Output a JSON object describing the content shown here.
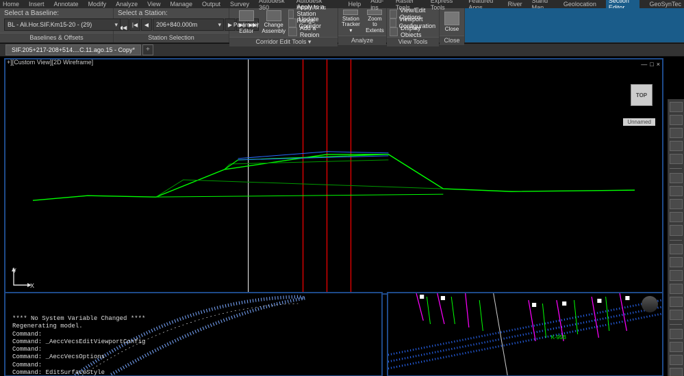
{
  "menu": {
    "items": [
      "Home",
      "Insert",
      "Annotate",
      "Modify",
      "Analyze",
      "View",
      "Manage",
      "Output",
      "Survey",
      "Autodesk 360",
      "Autodesk InfraWorks",
      "Help",
      "Add-ins",
      "Raster Tools",
      "Express Tools",
      "Featured Apps",
      "River",
      "Stand Man",
      "Geolocation",
      "Section Editor",
      "GeoSynTec"
    ],
    "active": "Section Editor"
  },
  "ribbon": {
    "baselines": {
      "label": "Select a Baseline:",
      "value": "BL - Ali.Hor.SIF.Km15-20 - (29)",
      "title": "Baselines & Offsets"
    },
    "station": {
      "label": "Select a Station:",
      "value": "206+840.000m",
      "title": "Station Selection",
      "nav": [
        "|◀◀",
        "|◀",
        "◀",
        "▶",
        "▶|",
        "▶▶|"
      ]
    },
    "tools": {
      "param": "Parameter Editor",
      "assem": "Change Assembly",
      "range": "Apply to a Station Range",
      "update": "Update Corridor",
      "region": "Add a Region",
      "title": "Corridor Edit Tools ▾"
    },
    "analyze": {
      "tracker": "Station Tracker ▾",
      "zoom": "Zoom to Extents",
      "title": "Analyze"
    },
    "view": {
      "opts": "View/Edit Options",
      "cfg": "Viewport Configuration",
      "disp": "Display Objects",
      "title": "View Tools"
    },
    "close": {
      "label": "Close",
      "title": "Close"
    }
  },
  "tab": {
    "name": "SIF.205+217-208+514....C.11.ago.15 - Copy*"
  },
  "viewport": {
    "label": "+][Custom View][2D Wireframe]",
    "cube": "TOP",
    "badge": "Unnamed",
    "controls": [
      "—",
      "□",
      "×"
    ]
  },
  "ucs": {
    "x": "X",
    "y": "Y"
  },
  "cmd": {
    "l1": "**** No System Variable Changed ****",
    "l2": "Regenerating model.",
    "l3": "Command:",
    "l4": "Command: _AeccVecsEditViewportConfig",
    "l5": "Command:",
    "l6": "Command: _AeccVecsOptions",
    "l7": "Command:",
    "l8": "Command: EditSurfaceStyle"
  },
  "plan_label": "K-95B"
}
